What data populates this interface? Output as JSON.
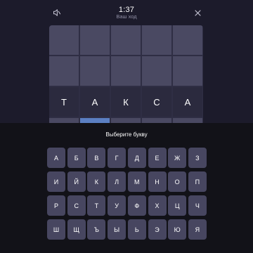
{
  "header": {
    "timer": "1:37",
    "turn_label": "Ваш ход",
    "sound_icon": "speaker-icon",
    "close_icon": "close-icon"
  },
  "board": {
    "rows": [
      [
        "",
        "",
        "",
        "",
        ""
      ],
      [
        "",
        "",
        "",
        "",
        ""
      ],
      [
        "Т",
        "А",
        "К",
        "С",
        "А"
      ],
      [
        "",
        "",
        "",
        "",
        ""
      ]
    ]
  },
  "keyboard": {
    "prompt": "Выберите букву",
    "rows": [
      [
        "А",
        "Б",
        "В",
        "Г",
        "Д",
        "Е",
        "Ж",
        "З"
      ],
      [
        "И",
        "Й",
        "К",
        "Л",
        "М",
        "Н",
        "О",
        "П"
      ],
      [
        "Р",
        "С",
        "Т",
        "У",
        "Ф",
        "Х",
        "Ц",
        "Ч"
      ],
      [
        "Ш",
        "Щ",
        "Ъ",
        "Ы",
        "Ь",
        "Э",
        "Ю",
        "Я"
      ]
    ]
  },
  "colors": {
    "background": "#1c1b2b",
    "panel": "#121218",
    "tile": "#4a4962",
    "key": "#474660",
    "cursor": "#5b7fc2"
  }
}
